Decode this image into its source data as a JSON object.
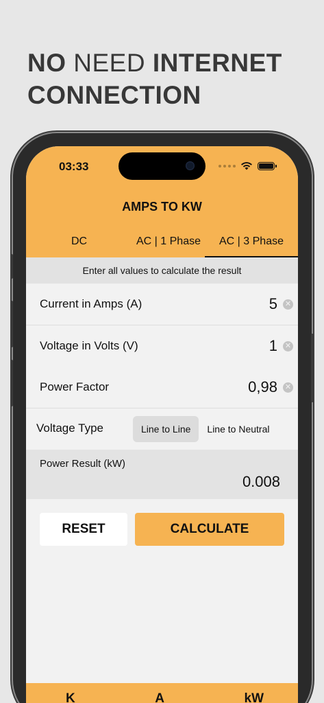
{
  "headline": {
    "word1": "NO",
    "word2": " NEED ",
    "word3": "INTERNET",
    "line2": "CONNECTION"
  },
  "status_bar": {
    "time": "03:33",
    "icons": [
      "signal-dots-icon",
      "wifi-icon",
      "battery-icon"
    ]
  },
  "nav": {
    "title": "AMPS TO KW"
  },
  "tabs": [
    {
      "label": "DC",
      "active": false
    },
    {
      "label": "AC | 1 Phase",
      "active": false
    },
    {
      "label": "AC | 3 Phase",
      "active": true
    }
  ],
  "hint": "Enter all values to calculate the result",
  "fields": [
    {
      "label": "Current in Amps (A)",
      "value": "5"
    },
    {
      "label": "Voltage in Volts (V)",
      "value": "1"
    },
    {
      "label": "Power Factor",
      "value": "0,98"
    }
  ],
  "voltage_type": {
    "label": "Voltage Type",
    "options": [
      "Line to Line",
      "Line to Neutral"
    ],
    "selected": "Line to Line"
  },
  "result": {
    "label": "Power Result (kW)",
    "value": "0.008"
  },
  "buttons": {
    "reset": "RESET",
    "calculate": "CALCULATE"
  },
  "bottom_bar": [
    "K",
    "A",
    "kW"
  ],
  "colors": {
    "accent": "#f6b352",
    "background": "#e7e7e7",
    "text": "#111111"
  }
}
